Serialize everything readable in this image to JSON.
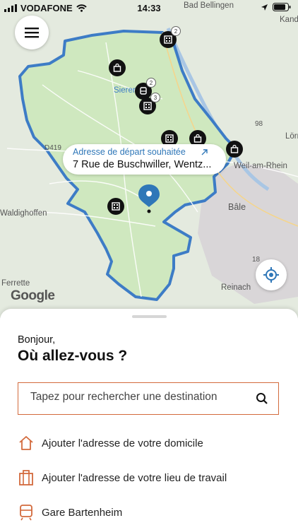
{
  "status_bar": {
    "carrier": "VODAFONE",
    "time": "14:33"
  },
  "map": {
    "tooltip": {
      "label": "Adresse de départ souhaitée",
      "address": "7 Rue de Buschwiller, Wentz..."
    },
    "place_labels": [
      "Sierentz",
      "Weil-am-Rhein",
      "Bâle",
      "Ferrette",
      "Reinach",
      "Waldighoffen",
      "Kandern",
      "Lörrach",
      "D419",
      "98",
      "18",
      "Bad Bellingen"
    ],
    "poi_badges": [
      "2",
      "2",
      "3"
    ],
    "attribution": "Google"
  },
  "sheet": {
    "greeting": "Bonjour,",
    "question": "Où allez-vous ?",
    "search_placeholder": "Tapez pour rechercher une destination",
    "shortcuts": [
      {
        "label": "Ajouter l'adresse de votre domicile",
        "icon": "home-icon"
      },
      {
        "label": "Ajouter l'adresse de votre lieu de travail",
        "icon": "briefcase-icon"
      },
      {
        "label": "Gare Bartenheim",
        "icon": "train-icon"
      }
    ]
  },
  "colors": {
    "accent": "#d36a3c",
    "zone_fill": "#cfe8bf",
    "zone_border": "#3d7cc6",
    "link_blue": "#2f77b8"
  }
}
